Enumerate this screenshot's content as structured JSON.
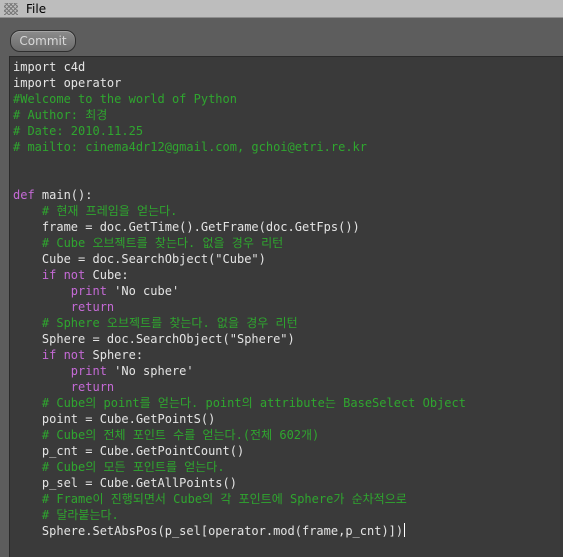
{
  "menu": {
    "file_label": "File"
  },
  "toolbar": {
    "commit_label": "Commit"
  },
  "code_lines": [
    [
      [
        "plain",
        "import c4d"
      ]
    ],
    [
      [
        "plain",
        "import operator"
      ]
    ],
    [
      [
        "cm",
        "#Welcome to the world of Python"
      ]
    ],
    [
      [
        "cm",
        "# Author: 최경"
      ]
    ],
    [
      [
        "cm",
        "# Date: 2010.11.25"
      ]
    ],
    [
      [
        "cm",
        "# mailto: cinema4dr12@gmail.com, gchoi@etri.re.kr"
      ]
    ],
    [
      [
        "plain",
        ""
      ]
    ],
    [
      [
        "plain",
        ""
      ]
    ],
    [
      [
        "kw",
        "def"
      ],
      [
        "plain",
        " main():"
      ]
    ],
    [
      [
        "plain",
        "    "
      ],
      [
        "cm",
        "# 현재 프레임을 얻는다."
      ]
    ],
    [
      [
        "plain",
        "    frame = doc.GetTime().GetFrame(doc.GetFps())"
      ]
    ],
    [
      [
        "plain",
        "    "
      ],
      [
        "cm",
        "# Cube 오브젝트를 찾는다. 없을 경우 리턴"
      ]
    ],
    [
      [
        "plain",
        "    Cube = doc.SearchObject(\"Cube\")"
      ]
    ],
    [
      [
        "plain",
        "    "
      ],
      [
        "kw",
        "if not"
      ],
      [
        "plain",
        " Cube:"
      ]
    ],
    [
      [
        "plain",
        "        "
      ],
      [
        "kw",
        "print"
      ],
      [
        "plain",
        " 'No cube'"
      ]
    ],
    [
      [
        "plain",
        "        "
      ],
      [
        "kw",
        "return"
      ]
    ],
    [
      [
        "plain",
        "    "
      ],
      [
        "cm",
        "# Sphere 오브젝트를 찾는다. 없을 경우 리턴"
      ]
    ],
    [
      [
        "plain",
        "    Sphere = doc.SearchObject(\"Sphere\")"
      ]
    ],
    [
      [
        "plain",
        "    "
      ],
      [
        "kw",
        "if not"
      ],
      [
        "plain",
        " Sphere:"
      ]
    ],
    [
      [
        "plain",
        "        "
      ],
      [
        "kw",
        "print"
      ],
      [
        "plain",
        " 'No sphere'"
      ]
    ],
    [
      [
        "plain",
        "        "
      ],
      [
        "kw",
        "return"
      ]
    ],
    [
      [
        "plain",
        "    "
      ],
      [
        "cm",
        "# Cube의 point를 얻는다. point의 attribute는 BaseSelect Object"
      ]
    ],
    [
      [
        "plain",
        "    point = Cube.GetPointS()"
      ]
    ],
    [
      [
        "plain",
        "    "
      ],
      [
        "cm",
        "# Cube의 전체 포인트 수를 얻는다.(전체 602개)"
      ]
    ],
    [
      [
        "plain",
        "    p_cnt = Cube.GetPointCount()"
      ]
    ],
    [
      [
        "plain",
        "    "
      ],
      [
        "cm",
        "# Cube의 모든 포인트를 얻는다."
      ]
    ],
    [
      [
        "plain",
        "    p_sel = Cube.GetAllPoints()"
      ]
    ],
    [
      [
        "plain",
        "    "
      ],
      [
        "cm",
        "# Frame이 진행되면서 Cube의 각 포인트에 Sphere가 순차적으로"
      ]
    ],
    [
      [
        "plain",
        "    "
      ],
      [
        "cm",
        "# 달라붙는다."
      ]
    ],
    [
      [
        "plain",
        "    Sphere.SetAbsPos(p_sel[operator.mod(frame,p_cnt)])"
      ],
      [
        "caret",
        ""
      ]
    ]
  ]
}
